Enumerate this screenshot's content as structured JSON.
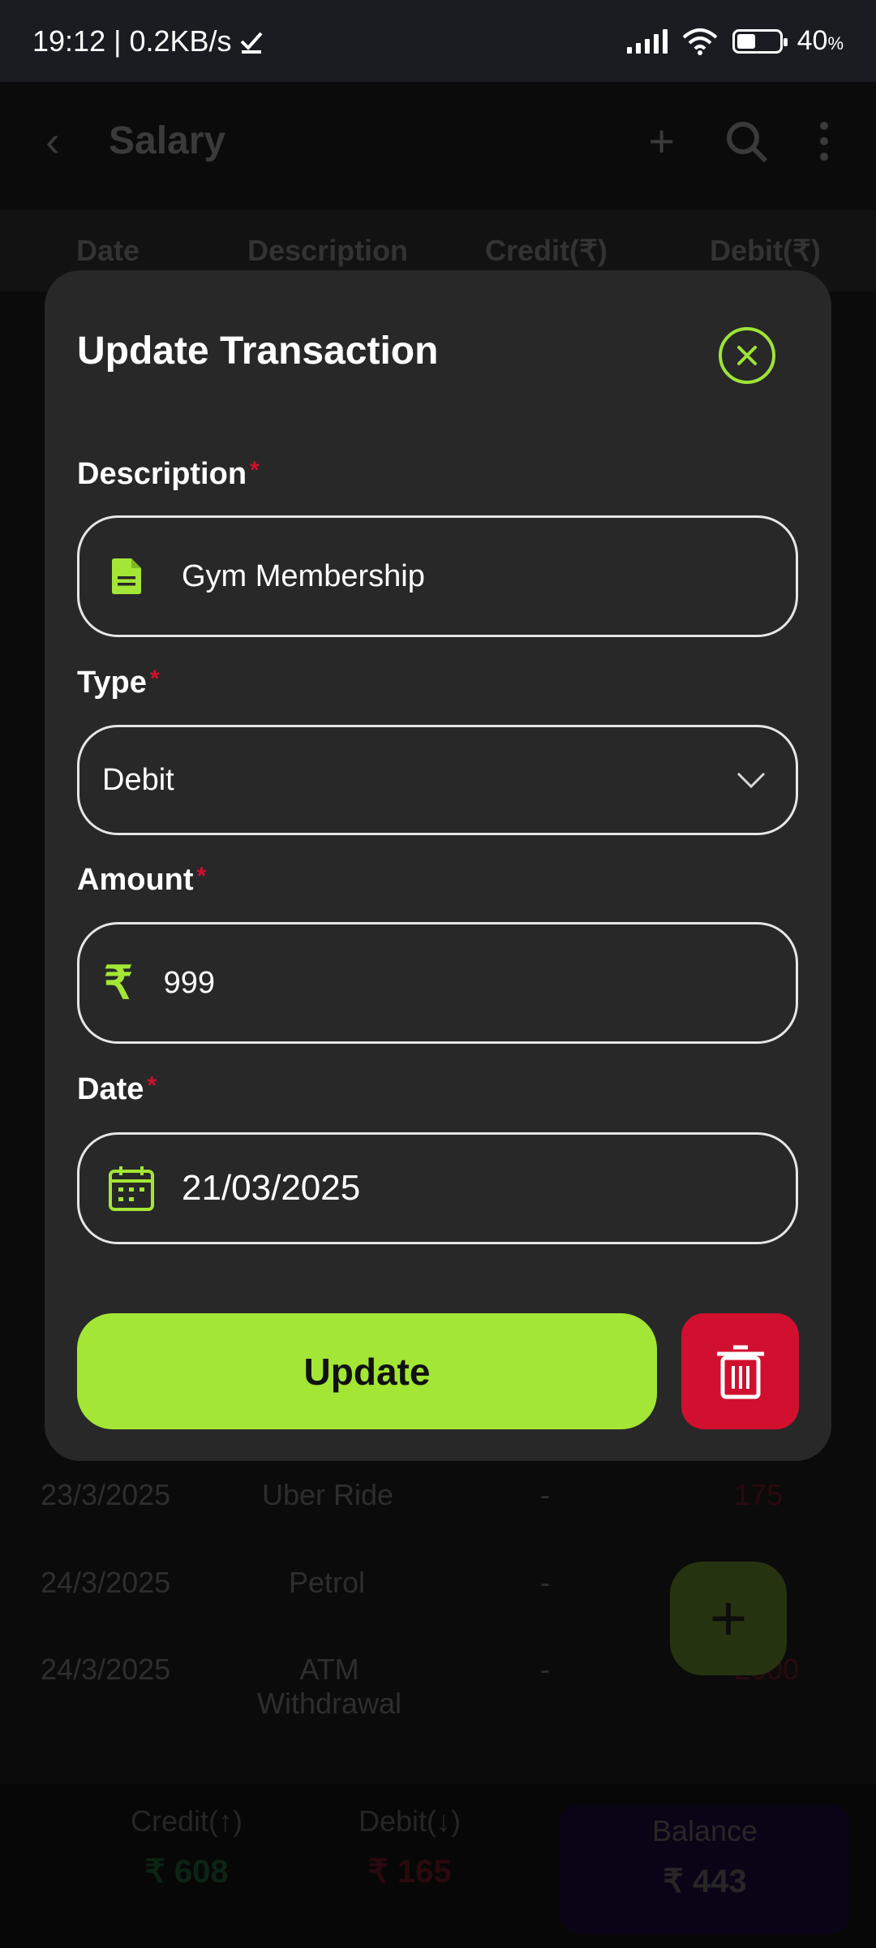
{
  "status_bar": {
    "time_speed": "19:12 | 0.2KB/s",
    "battery": "40"
  },
  "app_bar": {
    "title": "Salary"
  },
  "table": {
    "headers": [
      "Date",
      "Description",
      "Credit(₹)",
      "Debit(₹)"
    ],
    "rows": [
      {
        "date": "23/3/2025",
        "description": "Uber Ride",
        "credit": "-",
        "debit": "175"
      },
      {
        "date": "24/3/2025",
        "description": "Petrol",
        "credit": "-",
        "debit": ""
      },
      {
        "date": "24/3/2025",
        "description": "ATM Withdrawal",
        "credit": "-",
        "debit": "2000"
      }
    ]
  },
  "summary": {
    "credit_label": "Credit(↑)",
    "credit_value": "₹ 608",
    "debit_label": "Debit(↓)",
    "debit_value": "₹ 165",
    "balance_label": "Balance",
    "balance_value": "₹ 443"
  },
  "modal": {
    "title": "Update Transaction",
    "description_label": "Description",
    "description_value": "Gym Membership",
    "type_label": "Type",
    "type_value": "Debit",
    "amount_label": "Amount",
    "amount_value": "999",
    "date_label": "Date",
    "date_value": "21/03/2025",
    "required_mark": "*",
    "update_label": "Update"
  },
  "colors": {
    "accent": "#a3e635",
    "danger": "#d0102e",
    "modal_bg": "#282828"
  }
}
